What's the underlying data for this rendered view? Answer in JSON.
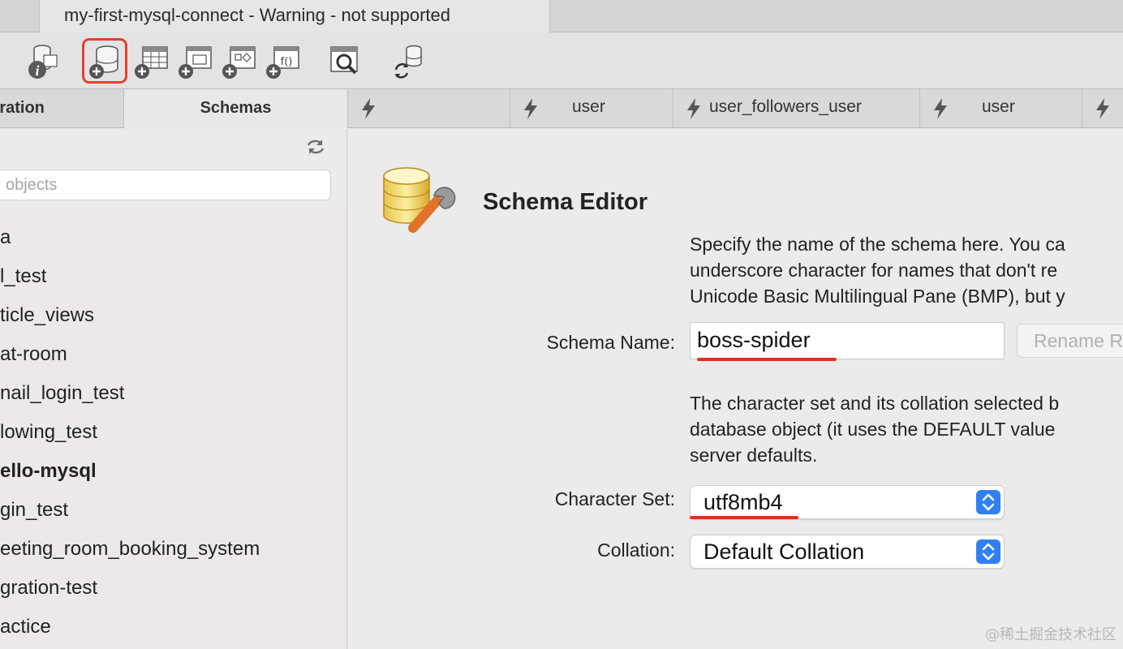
{
  "window": {
    "title": "my-first-mysql-connect - Warning - not supported"
  },
  "toolbar": {
    "buttons": [
      {
        "name": "server-info",
        "icon": "info-database-icon"
      },
      {
        "name": "create-schema",
        "icon": "add-database-icon",
        "highlighted": true
      },
      {
        "name": "create-table",
        "icon": "add-table-icon"
      },
      {
        "name": "create-view",
        "icon": "add-view-icon"
      },
      {
        "name": "create-procedure",
        "icon": "add-procedure-icon"
      },
      {
        "name": "create-function",
        "icon": "add-function-icon"
      },
      {
        "name": "search-table-data",
        "icon": "search-table-icon"
      },
      {
        "name": "reconnect",
        "icon": "reconnect-database-icon"
      }
    ],
    "highlight_color": "#e2402d"
  },
  "sidebar": {
    "tabs": [
      "istration",
      "Schemas"
    ],
    "filter_placeholder": " objects",
    "schemas": [
      "a",
      "l_test",
      "ticle_views",
      "at-room",
      "nail_login_test",
      "lowing_test",
      "ello-mysql",
      "gin_test",
      "eeting_room_booking_system",
      "gration-test",
      "actice"
    ],
    "active_schema": "ello-mysql"
  },
  "query_tabs": [
    "",
    "user",
    "user_followers_user",
    "user",
    ""
  ],
  "editor": {
    "title": "Schema Editor",
    "description_lines": [
      "Specify the name of the schema here. You ca",
      "underscore character for names that don't re",
      "Unicode Basic Multilingual Pane (BMP), but y"
    ],
    "schema_name_label": "Schema Name:",
    "schema_name_value": "boss-spider",
    "rename_button": "Rename R",
    "charset_description_lines": [
      "The character set and its collation selected b",
      "database object (it uses the DEFAULT value",
      "server defaults."
    ],
    "charset_label": "Character Set:",
    "charset_value": "utf8mb4",
    "collation_label": "Collation:",
    "collation_value": "Default Collation",
    "annotation_color": "#d8341f",
    "select_accent": "#2f7ff5"
  },
  "watermark": "@稀土掘金技术社区"
}
